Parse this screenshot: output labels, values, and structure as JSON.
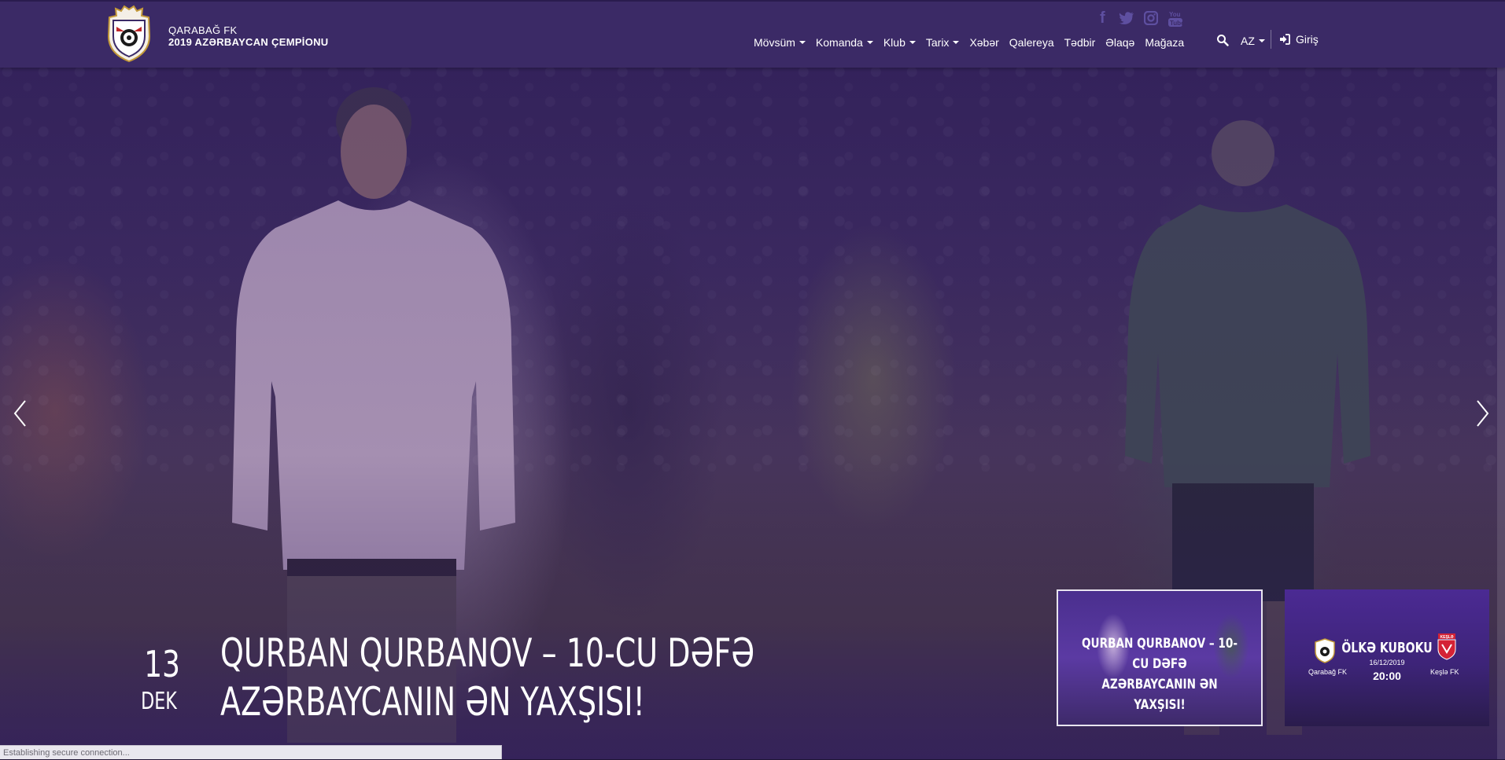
{
  "header": {
    "brand_name": "QARABAĞ FK",
    "brand_sub": "2019 AZƏRBAYCAN ÇEMPİONU",
    "social": [
      "facebook-icon",
      "twitter-icon",
      "instagram-icon",
      "youtube-icon"
    ],
    "nav": [
      {
        "label": "Mövsüm",
        "dropdown": true
      },
      {
        "label": "Komanda",
        "dropdown": true
      },
      {
        "label": "Klub",
        "dropdown": true
      },
      {
        "label": "Tarix",
        "dropdown": true
      },
      {
        "label": "Xəbər",
        "dropdown": false
      },
      {
        "label": "Qalereya",
        "dropdown": false
      },
      {
        "label": "Tədbir",
        "dropdown": false
      },
      {
        "label": "Əlaqə",
        "dropdown": false
      },
      {
        "label": "Mağaza",
        "dropdown": false
      }
    ],
    "language": "AZ",
    "login_label": "Giriş"
  },
  "slide": {
    "day": "13",
    "month": "DEK",
    "headline_line1": "QURBAN QURBANOV – 10-CU DƏFƏ",
    "headline_line2": "AZƏRBAYCANIN ƏN YAXŞISI!"
  },
  "thumbnails": {
    "first": {
      "title_line1": "QURBAN QURBANOV – 10-CU DƏFƏ",
      "title_line2": "AZƏRBAYCANIN ƏN YAXŞISI!"
    },
    "second": {
      "title": "ÖLKƏ KUBOKU",
      "home_team": "Qarabağ FK",
      "away_team": "Keşlə FK",
      "away_badge": "KEŞLƏ",
      "date": "16/12/2019",
      "time": "20:00"
    }
  },
  "status_bar": "Establishing secure connection...",
  "colors": {
    "header_bg": "#3b2a66",
    "social_icon": "#5e4fa0",
    "overlay_purple": "#3c2378"
  }
}
